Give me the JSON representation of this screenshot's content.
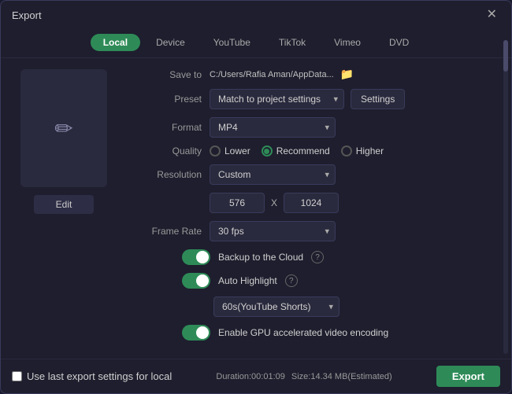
{
  "window": {
    "title": "Export",
    "close_label": "✕"
  },
  "tabs": [
    {
      "id": "local",
      "label": "Local",
      "active": true
    },
    {
      "id": "device",
      "label": "Device",
      "active": false
    },
    {
      "id": "youtube",
      "label": "YouTube",
      "active": false
    },
    {
      "id": "tiktok",
      "label": "TikTok",
      "active": false
    },
    {
      "id": "vimeo",
      "label": "Vimeo",
      "active": false
    },
    {
      "id": "dvd",
      "label": "DVD",
      "active": false
    }
  ],
  "preview": {
    "edit_label": "Edit"
  },
  "fields": {
    "save_to_label": "Save to",
    "save_to_path": "C:/Users/Rafia Aman/AppData...",
    "preset_label": "Preset",
    "preset_value": "Match to project settings",
    "settings_label": "Settings",
    "format_label": "Format",
    "format_value": "MP4",
    "quality_label": "Quality",
    "quality_options": [
      "Lower",
      "Recommend",
      "Higher"
    ],
    "quality_selected": "Recommend",
    "resolution_label": "Resolution",
    "resolution_value": "Custom",
    "resolution_w": "576",
    "resolution_x": "X",
    "resolution_h": "1024",
    "framerate_label": "Frame Rate",
    "framerate_value": "30 fps"
  },
  "toggles": {
    "backup_label": "Backup to the Cloud",
    "auto_highlight_label": "Auto Highlight",
    "gpu_label": "Enable GPU accelerated video encoding",
    "highlight_option": "60s(YouTube Shorts)"
  },
  "footer": {
    "checkbox_label": "Use last export settings for local",
    "duration_label": "Duration:00:01:09",
    "size_label": "Size:14.34 MB(Estimated)",
    "export_label": "Export"
  },
  "icons": {
    "folder": "📁",
    "help": "?",
    "edit_pencil": "✏"
  }
}
